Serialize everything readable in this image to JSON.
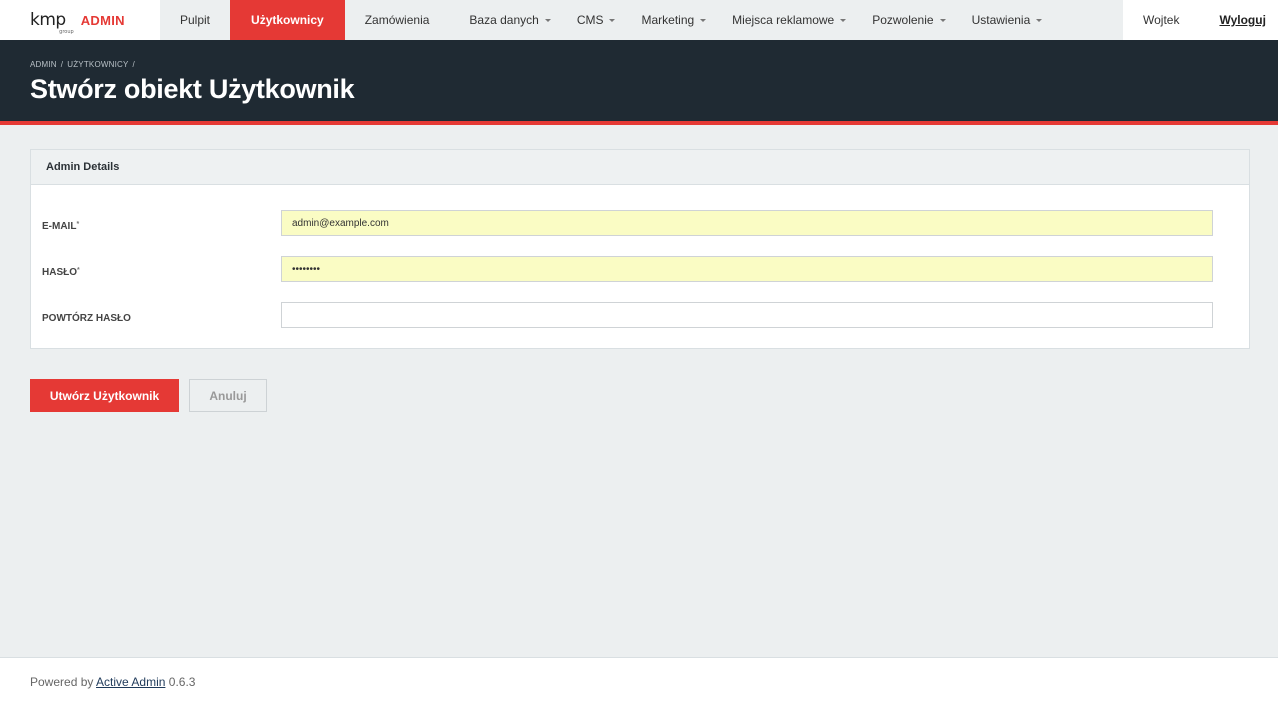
{
  "brand": {
    "logo_text": "kmp",
    "logo_sub": "group",
    "admin_label": "ADMIN"
  },
  "nav": {
    "items": [
      {
        "label": "Pulpit",
        "dropdown": false,
        "active": false
      },
      {
        "label": "Użytkownicy",
        "dropdown": false,
        "active": true
      },
      {
        "label": "Zamówienia",
        "dropdown": false,
        "active": false
      },
      {
        "label": "Baza danych",
        "dropdown": true,
        "active": false
      },
      {
        "label": "CMS",
        "dropdown": true,
        "active": false
      },
      {
        "label": "Marketing",
        "dropdown": true,
        "active": false
      },
      {
        "label": "Miejsca reklamowe",
        "dropdown": true,
        "active": false
      },
      {
        "label": "Pozwolenie",
        "dropdown": true,
        "active": false
      },
      {
        "label": "Ustawienia",
        "dropdown": true,
        "active": false
      }
    ]
  },
  "user": {
    "name": "Wojtek",
    "logout_label": "Wyloguj"
  },
  "breadcrumb": {
    "items": [
      "ADMIN",
      "UŻYTKOWNICY"
    ],
    "separator": "/"
  },
  "page_title": "Stwórz obiekt Użytkownik",
  "panel": {
    "title": "Admin Details",
    "fields": [
      {
        "label": "E-MAIL",
        "required": true,
        "value": "admin@example.com",
        "type": "email"
      },
      {
        "label": "HASŁO",
        "required": true,
        "value": "••••••••",
        "type": "password"
      },
      {
        "label": "POWTÓRZ HASŁO",
        "required": false,
        "value": "",
        "type": "password"
      }
    ],
    "required_marker": "*"
  },
  "actions": {
    "submit_label": "Utwórz Użytkownik",
    "cancel_label": "Anuluj"
  },
  "footer": {
    "prefix": "Powered by",
    "link_text": "Active Admin",
    "version": "0.6.3"
  },
  "colors": {
    "accent": "#e53935",
    "header_bg": "#1f2a33",
    "autofill_bg": "#fafcc4",
    "page_bg": "#eceff0"
  }
}
